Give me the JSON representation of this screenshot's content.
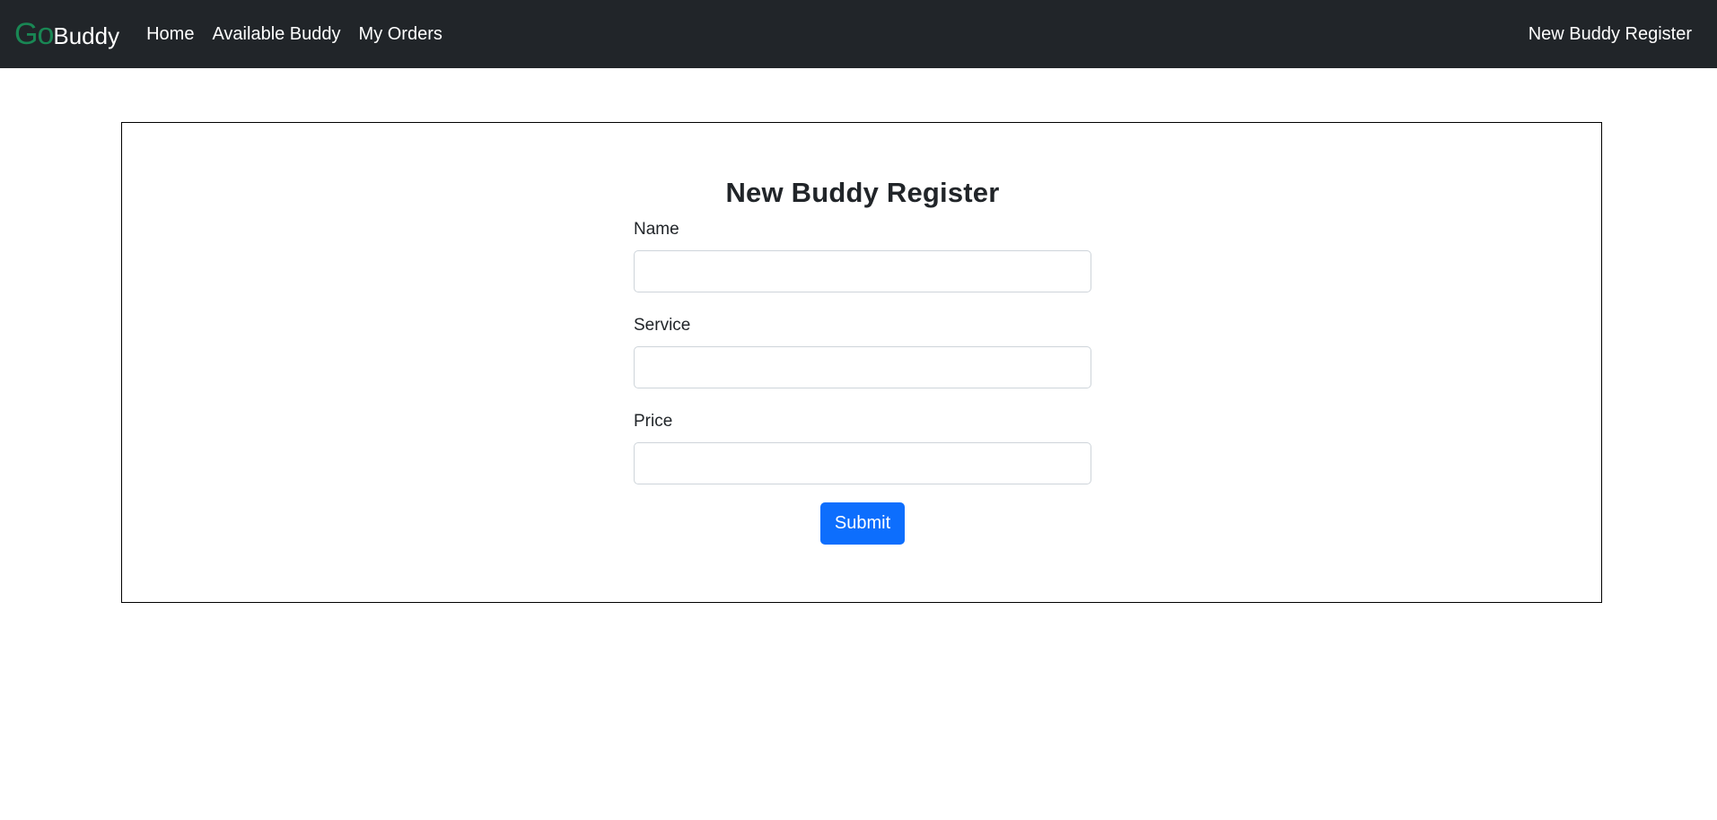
{
  "navbar": {
    "brand_go": "Go",
    "brand_buddy": "Buddy",
    "links": [
      "Home",
      "Available Buddy",
      "My Orders"
    ],
    "right_link": "New Buddy Register"
  },
  "form": {
    "title": "New Buddy Register",
    "fields": [
      {
        "label": "Name",
        "value": "",
        "placeholder": ""
      },
      {
        "label": "Service",
        "value": "",
        "placeholder": ""
      },
      {
        "label": "Price",
        "value": "",
        "placeholder": ""
      }
    ],
    "submit_label": "Submit"
  },
  "colors": {
    "navbar_bg": "#212529",
    "brand_green": "#198754",
    "primary_button": "#0d6efd",
    "card_border": "#000000"
  }
}
